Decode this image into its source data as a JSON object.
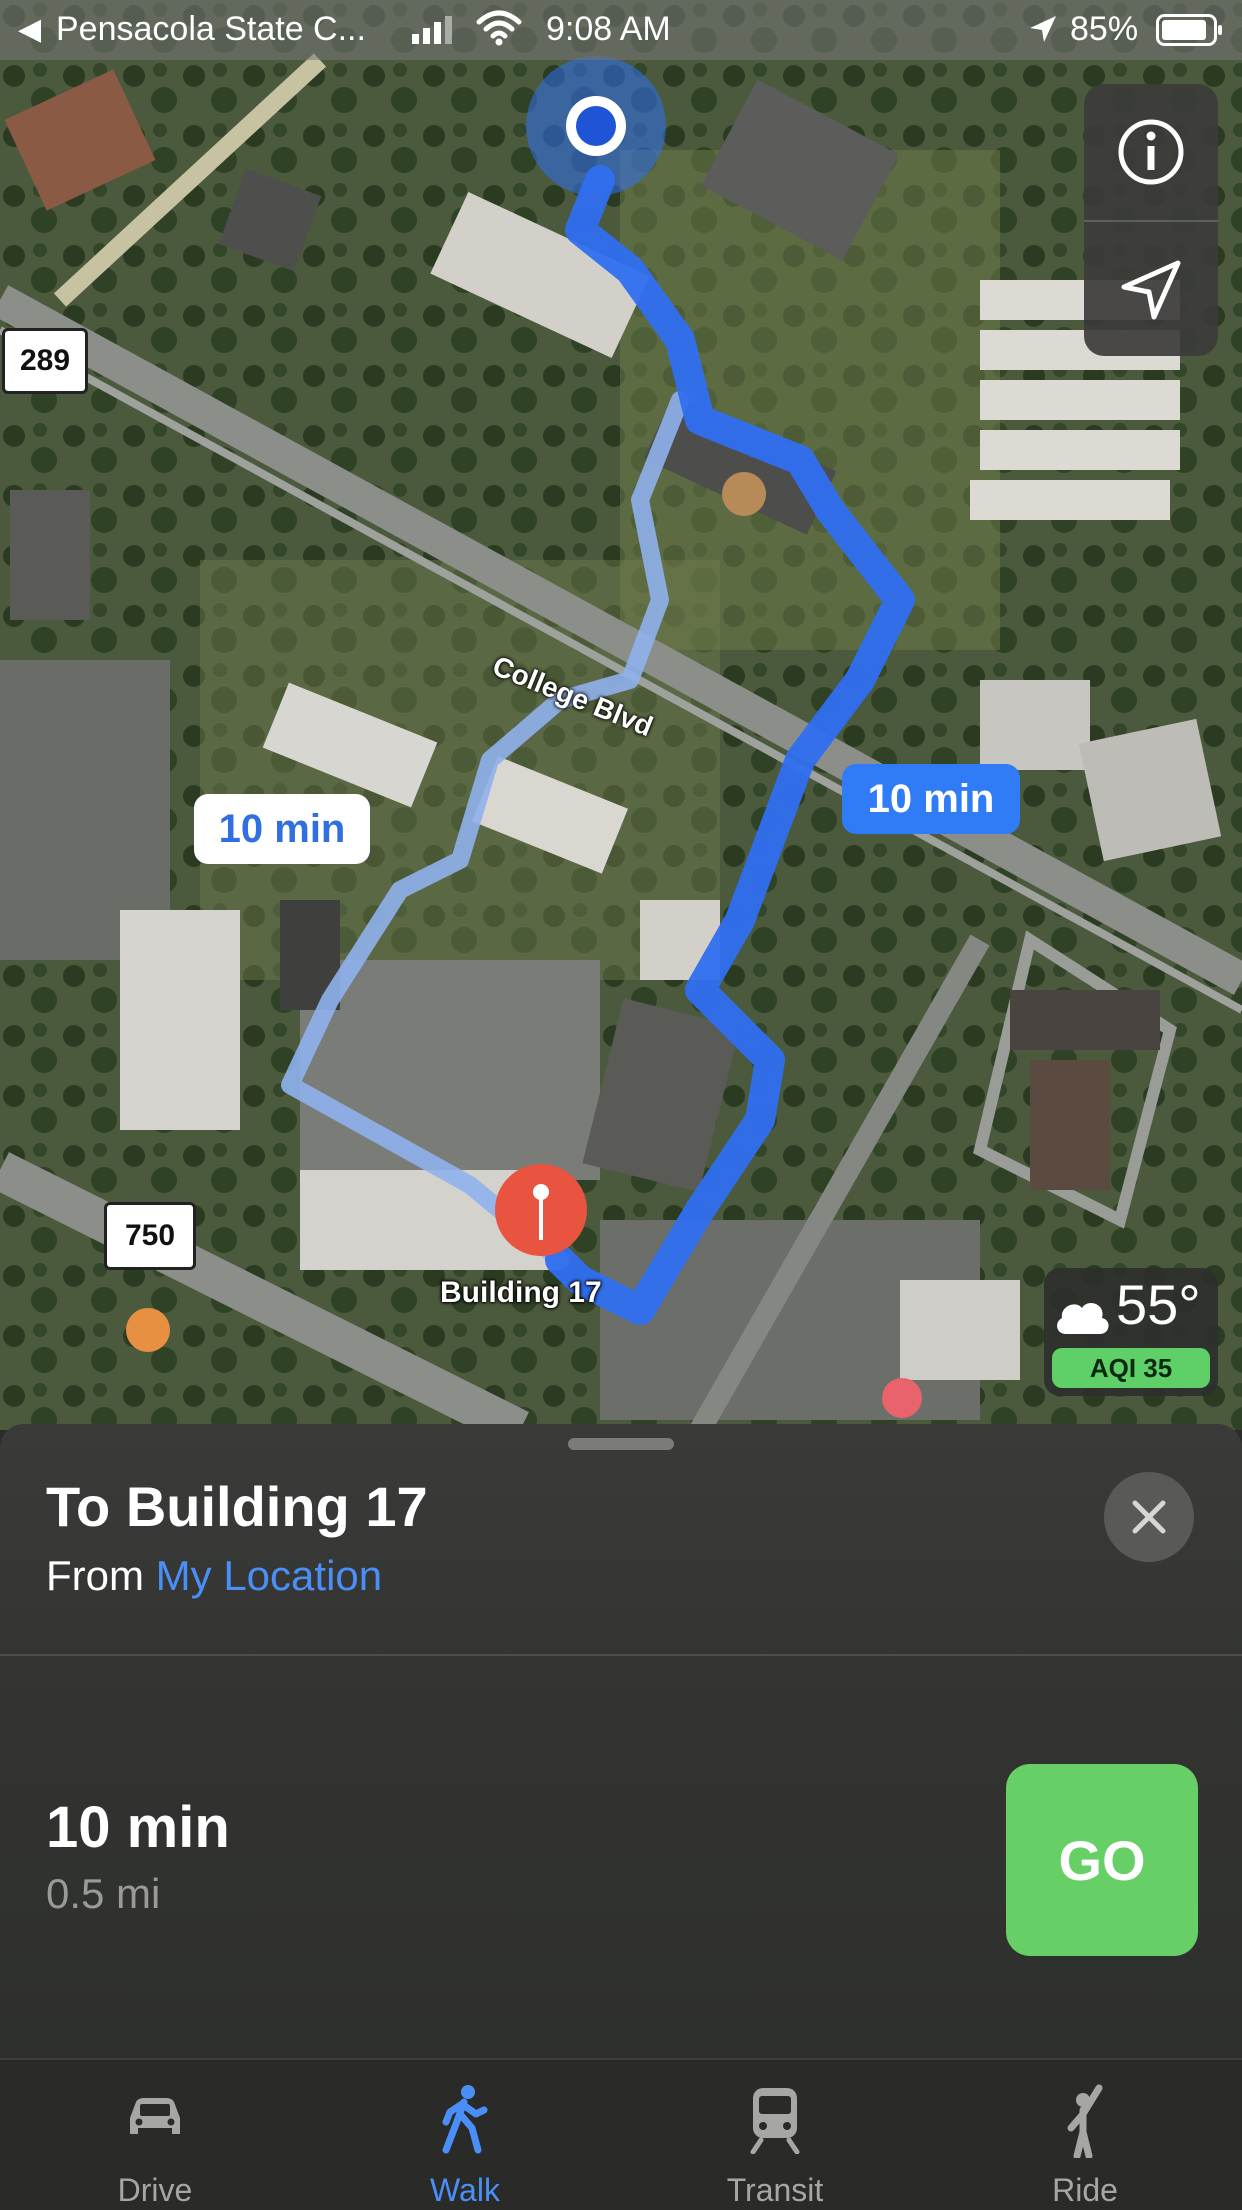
{
  "status_bar": {
    "back_app": "Pensacola State C...",
    "time": "9:08 AM",
    "battery": "85%"
  },
  "map": {
    "street_label": "College Blvd",
    "shield_289": "289",
    "shield_750": "750",
    "destination_pin_label": "Building 17",
    "route_primary_label": "10 min",
    "route_alternate_label": "10 min",
    "controls": {
      "info_icon": "info-icon",
      "location_icon": "location-arrow-icon"
    }
  },
  "weather": {
    "temperature": "55°",
    "aqi": "AQI 35",
    "icon": "cloud-icon"
  },
  "sheet": {
    "title": "To Building 17",
    "from_prefix": "From",
    "from_link": "My Location",
    "route_time": "10 min",
    "route_distance": "0.5 mi",
    "go_label": "GO"
  },
  "tabs": [
    {
      "label": "Drive",
      "icon": "car-icon",
      "active": false
    },
    {
      "label": "Walk",
      "icon": "walk-icon",
      "active": true
    },
    {
      "label": "Transit",
      "icon": "train-icon",
      "active": false
    },
    {
      "label": "Ride",
      "icon": "ride-icon",
      "active": false
    }
  ],
  "colors": {
    "accent": "#4a8ff7",
    "route": "#2f7cf6",
    "go": "#66cf66",
    "aqi": "#5fd068"
  }
}
